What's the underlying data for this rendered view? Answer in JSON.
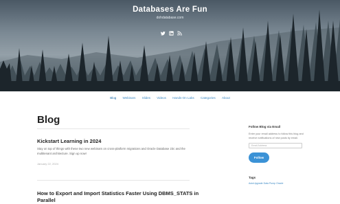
{
  "site": {
    "title": "Databases Are Fun",
    "tagline": "dohdatabase.com",
    "social_icons": [
      "twitter-icon",
      "linkedin-icon",
      "rss-icon"
    ]
  },
  "nav": {
    "items": [
      "Blog",
      "Webinars",
      "Slides",
      "Videos",
      "Hands-On Labs",
      "Categories",
      "About"
    ],
    "active": "Blog"
  },
  "main": {
    "heading": "Blog",
    "posts": [
      {
        "title": "Kickstart Learning in 2024",
        "excerpt": "Stay on top of things with these two new webinars on cross-platform migrations and Oracle Database 23c and the multitenant architecture. Sign up now!",
        "date": "January 22, 2024"
      },
      {
        "title": "How to Export and Import Statistics Faster Using DBMS_STATS in Parallel"
      }
    ]
  },
  "sidebar": {
    "follow_title": "Follow Blog via Email",
    "follow_text": "Enter your email address to follow this blog and receive notifications of new posts by email.",
    "email_placeholder": "Email Address",
    "follow_button": "Follow",
    "tags_title": "Tags",
    "tags_first": "AutoUpgrade Data Pump Oracle"
  },
  "colors": {
    "accent": "#3b92d6",
    "link": "#3a88c4",
    "sky": "#94a0a8",
    "forest": "#1c252b"
  }
}
